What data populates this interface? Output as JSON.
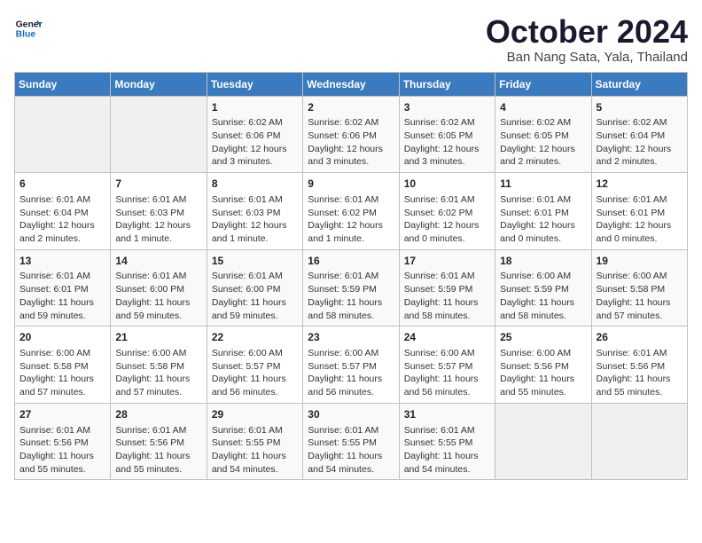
{
  "logo": {
    "line1": "General",
    "line2": "Blue"
  },
  "title": "October 2024",
  "location": "Ban Nang Sata, Yala, Thailand",
  "weekdays": [
    "Sunday",
    "Monday",
    "Tuesday",
    "Wednesday",
    "Thursday",
    "Friday",
    "Saturday"
  ],
  "weeks": [
    [
      {
        "day": "",
        "sunrise": "",
        "sunset": "",
        "daylight": ""
      },
      {
        "day": "",
        "sunrise": "",
        "sunset": "",
        "daylight": ""
      },
      {
        "day": "1",
        "sunrise": "Sunrise: 6:02 AM",
        "sunset": "Sunset: 6:06 PM",
        "daylight": "Daylight: 12 hours and 3 minutes."
      },
      {
        "day": "2",
        "sunrise": "Sunrise: 6:02 AM",
        "sunset": "Sunset: 6:06 PM",
        "daylight": "Daylight: 12 hours and 3 minutes."
      },
      {
        "day": "3",
        "sunrise": "Sunrise: 6:02 AM",
        "sunset": "Sunset: 6:05 PM",
        "daylight": "Daylight: 12 hours and 3 minutes."
      },
      {
        "day": "4",
        "sunrise": "Sunrise: 6:02 AM",
        "sunset": "Sunset: 6:05 PM",
        "daylight": "Daylight: 12 hours and 2 minutes."
      },
      {
        "day": "5",
        "sunrise": "Sunrise: 6:02 AM",
        "sunset": "Sunset: 6:04 PM",
        "daylight": "Daylight: 12 hours and 2 minutes."
      }
    ],
    [
      {
        "day": "6",
        "sunrise": "Sunrise: 6:01 AM",
        "sunset": "Sunset: 6:04 PM",
        "daylight": "Daylight: 12 hours and 2 minutes."
      },
      {
        "day": "7",
        "sunrise": "Sunrise: 6:01 AM",
        "sunset": "Sunset: 6:03 PM",
        "daylight": "Daylight: 12 hours and 1 minute."
      },
      {
        "day": "8",
        "sunrise": "Sunrise: 6:01 AM",
        "sunset": "Sunset: 6:03 PM",
        "daylight": "Daylight: 12 hours and 1 minute."
      },
      {
        "day": "9",
        "sunrise": "Sunrise: 6:01 AM",
        "sunset": "Sunset: 6:02 PM",
        "daylight": "Daylight: 12 hours and 1 minute."
      },
      {
        "day": "10",
        "sunrise": "Sunrise: 6:01 AM",
        "sunset": "Sunset: 6:02 PM",
        "daylight": "Daylight: 12 hours and 0 minutes."
      },
      {
        "day": "11",
        "sunrise": "Sunrise: 6:01 AM",
        "sunset": "Sunset: 6:01 PM",
        "daylight": "Daylight: 12 hours and 0 minutes."
      },
      {
        "day": "12",
        "sunrise": "Sunrise: 6:01 AM",
        "sunset": "Sunset: 6:01 PM",
        "daylight": "Daylight: 12 hours and 0 minutes."
      }
    ],
    [
      {
        "day": "13",
        "sunrise": "Sunrise: 6:01 AM",
        "sunset": "Sunset: 6:01 PM",
        "daylight": "Daylight: 11 hours and 59 minutes."
      },
      {
        "day": "14",
        "sunrise": "Sunrise: 6:01 AM",
        "sunset": "Sunset: 6:00 PM",
        "daylight": "Daylight: 11 hours and 59 minutes."
      },
      {
        "day": "15",
        "sunrise": "Sunrise: 6:01 AM",
        "sunset": "Sunset: 6:00 PM",
        "daylight": "Daylight: 11 hours and 59 minutes."
      },
      {
        "day": "16",
        "sunrise": "Sunrise: 6:01 AM",
        "sunset": "Sunset: 5:59 PM",
        "daylight": "Daylight: 11 hours and 58 minutes."
      },
      {
        "day": "17",
        "sunrise": "Sunrise: 6:01 AM",
        "sunset": "Sunset: 5:59 PM",
        "daylight": "Daylight: 11 hours and 58 minutes."
      },
      {
        "day": "18",
        "sunrise": "Sunrise: 6:00 AM",
        "sunset": "Sunset: 5:59 PM",
        "daylight": "Daylight: 11 hours and 58 minutes."
      },
      {
        "day": "19",
        "sunrise": "Sunrise: 6:00 AM",
        "sunset": "Sunset: 5:58 PM",
        "daylight": "Daylight: 11 hours and 57 minutes."
      }
    ],
    [
      {
        "day": "20",
        "sunrise": "Sunrise: 6:00 AM",
        "sunset": "Sunset: 5:58 PM",
        "daylight": "Daylight: 11 hours and 57 minutes."
      },
      {
        "day": "21",
        "sunrise": "Sunrise: 6:00 AM",
        "sunset": "Sunset: 5:58 PM",
        "daylight": "Daylight: 11 hours and 57 minutes."
      },
      {
        "day": "22",
        "sunrise": "Sunrise: 6:00 AM",
        "sunset": "Sunset: 5:57 PM",
        "daylight": "Daylight: 11 hours and 56 minutes."
      },
      {
        "day": "23",
        "sunrise": "Sunrise: 6:00 AM",
        "sunset": "Sunset: 5:57 PM",
        "daylight": "Daylight: 11 hours and 56 minutes."
      },
      {
        "day": "24",
        "sunrise": "Sunrise: 6:00 AM",
        "sunset": "Sunset: 5:57 PM",
        "daylight": "Daylight: 11 hours and 56 minutes."
      },
      {
        "day": "25",
        "sunrise": "Sunrise: 6:00 AM",
        "sunset": "Sunset: 5:56 PM",
        "daylight": "Daylight: 11 hours and 55 minutes."
      },
      {
        "day": "26",
        "sunrise": "Sunrise: 6:01 AM",
        "sunset": "Sunset: 5:56 PM",
        "daylight": "Daylight: 11 hours and 55 minutes."
      }
    ],
    [
      {
        "day": "27",
        "sunrise": "Sunrise: 6:01 AM",
        "sunset": "Sunset: 5:56 PM",
        "daylight": "Daylight: 11 hours and 55 minutes."
      },
      {
        "day": "28",
        "sunrise": "Sunrise: 6:01 AM",
        "sunset": "Sunset: 5:56 PM",
        "daylight": "Daylight: 11 hours and 55 minutes."
      },
      {
        "day": "29",
        "sunrise": "Sunrise: 6:01 AM",
        "sunset": "Sunset: 5:55 PM",
        "daylight": "Daylight: 11 hours and 54 minutes."
      },
      {
        "day": "30",
        "sunrise": "Sunrise: 6:01 AM",
        "sunset": "Sunset: 5:55 PM",
        "daylight": "Daylight: 11 hours and 54 minutes."
      },
      {
        "day": "31",
        "sunrise": "Sunrise: 6:01 AM",
        "sunset": "Sunset: 5:55 PM",
        "daylight": "Daylight: 11 hours and 54 minutes."
      },
      {
        "day": "",
        "sunrise": "",
        "sunset": "",
        "daylight": ""
      },
      {
        "day": "",
        "sunrise": "",
        "sunset": "",
        "daylight": ""
      }
    ]
  ]
}
